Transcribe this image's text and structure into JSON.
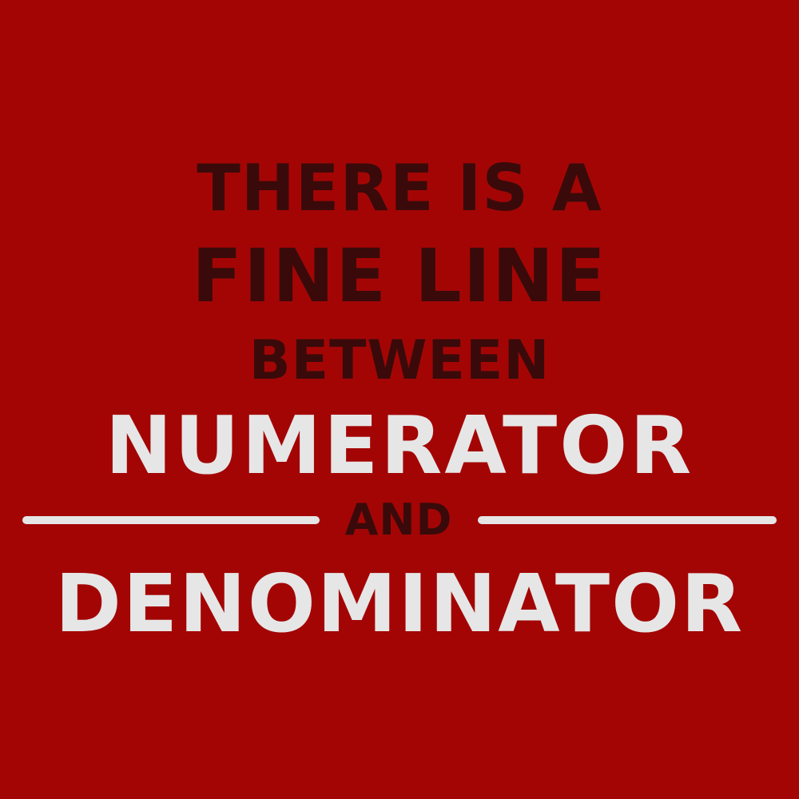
{
  "background_color": "#a30505",
  "dark_text_color": "#3a0a0a",
  "light_text_color": "#e6e6e6",
  "lines": {
    "line1": "THERE IS A",
    "line2": "FINE LINE",
    "line3": "BETWEEN",
    "line4": "NUMERATOR",
    "line5": "AND",
    "line6": "DENOMINATOR"
  }
}
